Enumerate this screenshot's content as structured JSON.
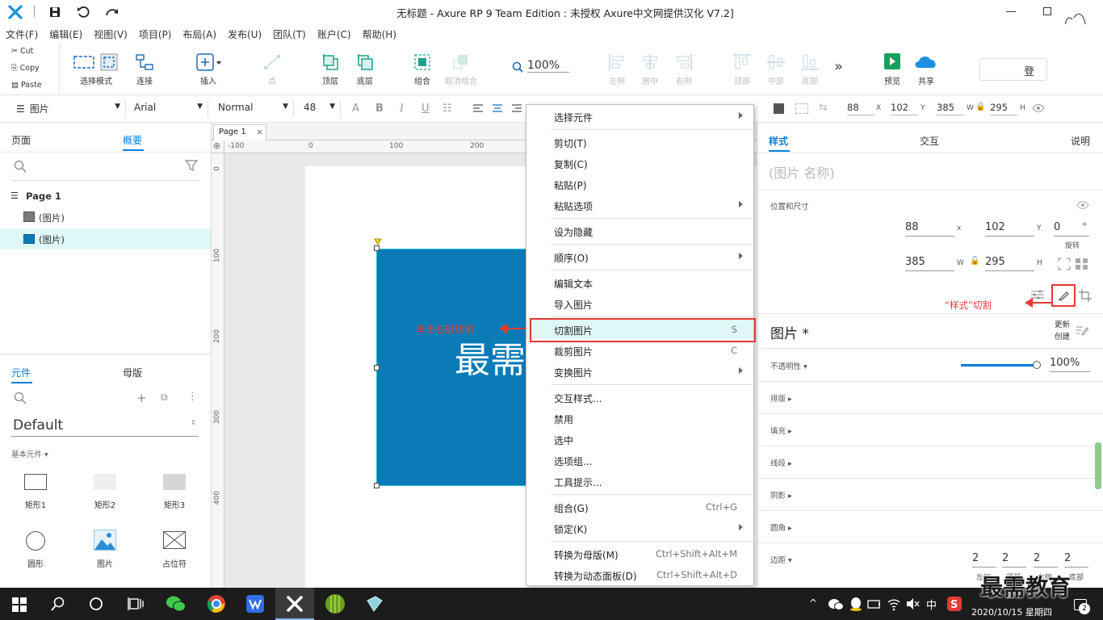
{
  "title": {
    "text": "无标题 - Axure RP 9 Team Edition : 未授权    Axure中文网提供汉化 V7.2]"
  },
  "menu": [
    "文件(F)",
    "编辑(E)",
    "视图(V)",
    "项目(P)",
    "布局(A)",
    "发布(U)",
    "团队(T)",
    "账户(C)",
    "帮助(H)"
  ],
  "clipboard": {
    "cut": "Cut",
    "copy": "Copy",
    "paste": "Paste"
  },
  "toolbar": {
    "select_mode": "选择模式",
    "connect": "连接",
    "insert": "插入",
    "point": "点",
    "top_layer": "顶层",
    "bottom_layer": "底层",
    "group": "组合",
    "ungroup": "取消组合",
    "zoom": "100%",
    "left": "左侧",
    "center": "居中",
    "right": "右侧",
    "top": "顶部",
    "middle": "中部",
    "bottom": "底部",
    "more": "»",
    "preview": "预览",
    "share": "共享",
    "login": "登"
  },
  "format": {
    "widget_type": "图片",
    "font": "Arial",
    "weight": "Normal",
    "size": "48",
    "x": "88",
    "y": "102",
    "w": "385",
    "h": "295",
    "x_l": "X",
    "y_l": "Y",
    "w_l": "W",
    "h_l": "H"
  },
  "left": {
    "tab_pages": "页面",
    "tab_outline": "概要",
    "page_name": "Page 1",
    "item1": "(图片)",
    "item2": "(图片)",
    "tab_widgets": "元件",
    "tab_masters": "母版",
    "library": "Default",
    "basic": "基本元件 ▾",
    "widgets": [
      "矩形1",
      "矩形2",
      "矩形3",
      "圆形",
      "图片",
      "占位符"
    ]
  },
  "canvas": {
    "tab": "Page 1",
    "ruler_h": [
      "-100",
      "0",
      "100",
      "200"
    ],
    "ruler_v": [
      "0",
      "100",
      "200",
      "300",
      "400"
    ],
    "image_text": "最需",
    "annotation": "单击右键切割"
  },
  "context_menu": [
    {
      "label": "选择元件",
      "shortcut": "",
      "sub": true
    },
    {
      "label": "剪切(T)",
      "shortcut": "",
      "sub": false
    },
    {
      "label": "复制(C)",
      "shortcut": "",
      "sub": false
    },
    {
      "label": "粘贴(P)",
      "shortcut": "",
      "sub": false
    },
    {
      "label": "粘贴选项",
      "shortcut": "",
      "sub": true
    },
    {
      "label": "设为隐藏",
      "shortcut": "",
      "sub": false
    },
    {
      "label": "顺序(O)",
      "shortcut": "",
      "sub": true
    },
    {
      "label": "编辑文本",
      "shortcut": "",
      "sub": false
    },
    {
      "label": "导入图片",
      "shortcut": "",
      "sub": false
    },
    {
      "label": "切割图片",
      "shortcut": "S",
      "sub": false
    },
    {
      "label": "裁剪图片",
      "shortcut": "C",
      "sub": false
    },
    {
      "label": "变换图片",
      "shortcut": "",
      "sub": true
    },
    {
      "label": "交互样式...",
      "shortcut": "",
      "sub": false
    },
    {
      "label": "禁用",
      "shortcut": "",
      "sub": false
    },
    {
      "label": "选中",
      "shortcut": "",
      "sub": false
    },
    {
      "label": "选项组...",
      "shortcut": "",
      "sub": false
    },
    {
      "label": "工具提示...",
      "shortcut": "",
      "sub": false
    },
    {
      "label": "组合(G)",
      "shortcut": "Ctrl+G",
      "sub": false
    },
    {
      "label": "锁定(K)",
      "shortcut": "",
      "sub": true
    },
    {
      "label": "转换为母版(M)",
      "shortcut": "Ctrl+Shift+Alt+M",
      "sub": false
    },
    {
      "label": "转换为动态面板(D)",
      "shortcut": "Ctrl+Shift+Alt+D",
      "sub": false
    }
  ],
  "right": {
    "tab_style": "样式",
    "tab_interact": "交互",
    "tab_notes": "说明",
    "name_placeholder": "(图片 名称)",
    "pos_size": "位置和尺寸",
    "x": "88",
    "y": "102",
    "rot": "0",
    "w": "385",
    "h": "295",
    "x_l": "x",
    "y_l": "Y",
    "w_l": "W",
    "h_l": "H",
    "rot_l": "旋转",
    "deg": "°",
    "annotation": "“样式”切割",
    "style_name": "图片 *",
    "update": "更新",
    "create": "创建",
    "opacity_label": "不透明性 ▾",
    "opacity": "100%",
    "opacity_fraction": 1.0,
    "sections": [
      "排版",
      "填充",
      "线段",
      "阴影",
      "圆角",
      "边距"
    ],
    "padding": [
      "2",
      "2",
      "2",
      "2"
    ],
    "padding_labels": [
      "左侧",
      "顶部",
      "右侧",
      "底部"
    ]
  },
  "taskbar": {
    "ime": "中",
    "time": "9:",
    "date": "2020/10/15 星期四",
    "badge": "2",
    "watermark": "最需教育"
  },
  "colors": {
    "accent": "#0a7dd8",
    "image_fill": "#0b7bb8",
    "highlight_red": "#e53935",
    "selection_row": "#e0f7f7"
  }
}
